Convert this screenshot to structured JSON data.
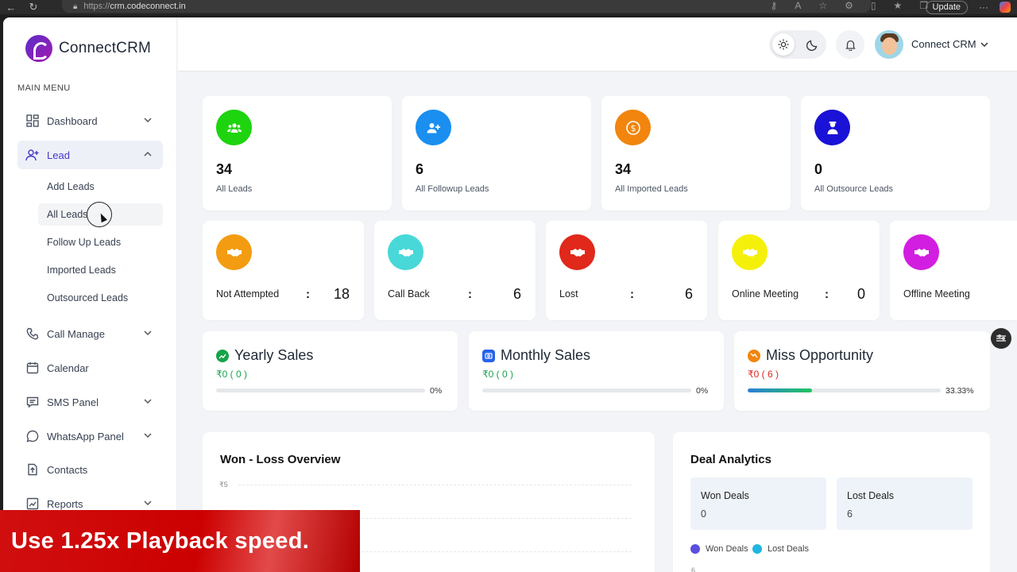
{
  "browser": {
    "url_scheme": "https://",
    "url_host": "crm.codeconnect.in",
    "update_label": "Update"
  },
  "brand": {
    "name": "ConnectCRM"
  },
  "sidebar": {
    "menu_title": "MAIN MENU",
    "items": [
      {
        "label": "Dashboard",
        "icon": "dashboard-icon"
      },
      {
        "label": "Lead",
        "icon": "user-plus-icon"
      },
      {
        "label": "Call Manage",
        "icon": "phone-icon"
      },
      {
        "label": "Calendar",
        "icon": "calendar-icon"
      },
      {
        "label": "SMS Panel",
        "icon": "message-icon"
      },
      {
        "label": "WhatsApp Panel",
        "icon": "whatsapp-icon"
      },
      {
        "label": "Contacts",
        "icon": "contacts-icon"
      },
      {
        "label": "Reports",
        "icon": "reports-icon"
      }
    ],
    "lead_subitems": [
      "Add Leads",
      "All Leads",
      "Follow Up Leads",
      "Imported Leads",
      "Outsourced Leads"
    ]
  },
  "header": {
    "user_name": "Connect CRM"
  },
  "stats": [
    {
      "value": "34",
      "label": "All Leads",
      "color": "#1ed40f",
      "icon": "users-icon"
    },
    {
      "value": "6",
      "label": "All Followup Leads",
      "color": "#1a8ff0",
      "icon": "user-plus-icon"
    },
    {
      "value": "34",
      "label": "All Imported Leads",
      "color": "#f2850d",
      "icon": "dollar-icon"
    },
    {
      "value": "0",
      "label": "All Outsource Leads",
      "color": "#1a12d6",
      "icon": "agent-icon"
    }
  ],
  "statuses": [
    {
      "label": "Not Attempted",
      "value": "18",
      "color": "#f39c12"
    },
    {
      "label": "Call Back",
      "value": "6",
      "color": "#48d8d8"
    },
    {
      "label": "Lost",
      "value": "6",
      "color": "#e0281b"
    },
    {
      "label": "Online Meeting",
      "value": "0",
      "color": "#f5f00a"
    },
    {
      "label": "Offline Meeting",
      "value": "",
      "color": "#d21ee0"
    }
  ],
  "sales": [
    {
      "title": "Yearly Sales",
      "amount": "₹0 ( 0 )",
      "pct": "0%",
      "fraction": 0,
      "color": "#17a34a",
      "icon_color": "#16a34a"
    },
    {
      "title": "Monthly Sales",
      "amount": "₹0 ( 0 )",
      "pct": "0%",
      "fraction": 0,
      "color": "#17a34a",
      "icon_color": "#2563eb"
    },
    {
      "title": "Miss Opportunity",
      "amount": "₹0 ( 6 )",
      "pct": "33.33%",
      "fraction": 0.3333,
      "color": "#dc2626",
      "icon_color": "#f2850d"
    }
  ],
  "won_loss": {
    "title": "Won - Loss Overview",
    "y_tick_top": "₹5"
  },
  "deal_analytics": {
    "title": "Deal Analytics",
    "won_label": "Won Deals",
    "won_value": "0",
    "lost_label": "Lost Deals",
    "lost_value": "6",
    "legend_won": "Won Deals",
    "legend_lost": "Lost Deals",
    "won_color": "#5b4ee0",
    "lost_color": "#1fb6e0",
    "axis_tick": "6"
  },
  "banner": {
    "text": "Use 1.25x Playback speed."
  }
}
